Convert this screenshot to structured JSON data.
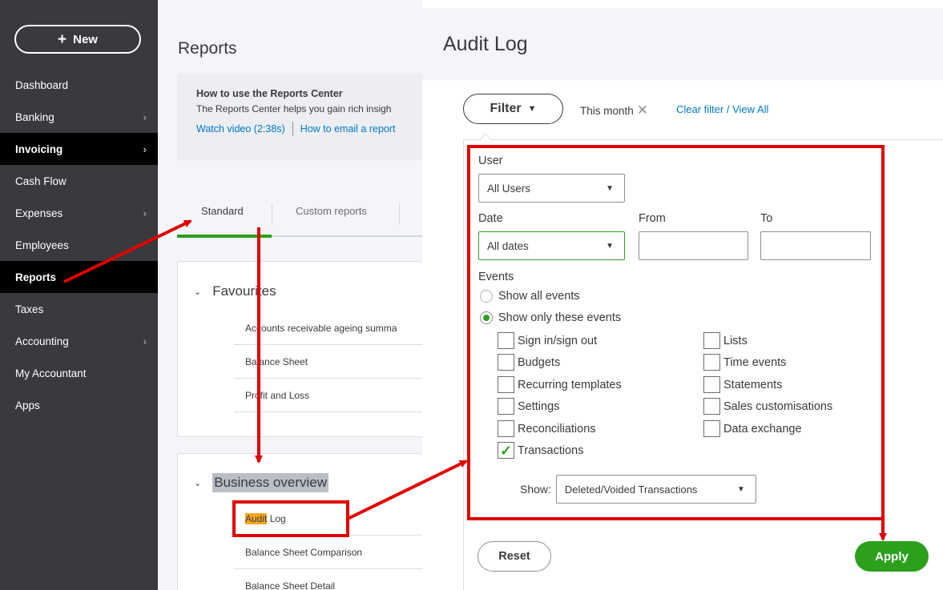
{
  "sidebar": {
    "new_label": "New",
    "items": [
      {
        "label": "Dashboard",
        "chevron": false,
        "active": false
      },
      {
        "label": "Banking",
        "chevron": true,
        "active": false
      },
      {
        "label": "Invoicing",
        "chevron": true,
        "active": true
      },
      {
        "label": "Cash Flow",
        "chevron": false,
        "active": false
      },
      {
        "label": "Expenses",
        "chevron": true,
        "active": false
      },
      {
        "label": "Employees",
        "chevron": false,
        "active": false
      },
      {
        "label": "Reports",
        "chevron": false,
        "active": true
      },
      {
        "label": "Taxes",
        "chevron": false,
        "active": false
      },
      {
        "label": "Accounting",
        "chevron": true,
        "active": false
      },
      {
        "label": "My Accountant",
        "chevron": false,
        "active": false
      },
      {
        "label": "Apps",
        "chevron": false,
        "active": false
      }
    ]
  },
  "reports": {
    "title": "Reports",
    "info_title": "How to use the Reports Center",
    "info_text": "The Reports Center helps you gain rich insigh",
    "watch_video": "Watch video (2:38s)",
    "email_link": "How to email a report",
    "tab_standard": "Standard",
    "tab_custom": "Custom reports",
    "favourites_title": "Favourites",
    "favourites": [
      "Accounts receivable ageing summa",
      "Balance Sheet",
      "Profit and Loss"
    ],
    "business_title": "Business overview",
    "audit_mark": "Audit",
    "audit_rest": " Log",
    "business_rows": [
      "Balance Sheet Comparison",
      "Balance Sheet Detail"
    ]
  },
  "audit": {
    "title": "Audit Log",
    "filter_label": "Filter",
    "this_month": "This month",
    "clear_link": "Clear filter / View All",
    "user_label": "User",
    "user_value": "All Users",
    "date_label": "Date",
    "date_value": "All dates",
    "from_label": "From",
    "to_label": "To",
    "events_label": "Events",
    "show_all": "Show all events",
    "show_only": "Show only these events",
    "events_left": [
      {
        "label": "Sign in/sign out",
        "checked": false
      },
      {
        "label": "Budgets",
        "checked": false
      },
      {
        "label": "Recurring templates",
        "checked": false
      },
      {
        "label": "Settings",
        "checked": false
      },
      {
        "label": "Reconciliations",
        "checked": false
      },
      {
        "label": "Transactions",
        "checked": true
      }
    ],
    "events_right": [
      {
        "label": "Lists",
        "checked": false
      },
      {
        "label": "Time events",
        "checked": false
      },
      {
        "label": "Statements",
        "checked": false
      },
      {
        "label": "Sales customisations",
        "checked": false
      },
      {
        "label": "Data exchange",
        "checked": false
      }
    ],
    "show_label": "Show:",
    "show_value": "Deleted/Voided Transactions",
    "reset_label": "Reset",
    "apply_label": "Apply"
  },
  "colors": {
    "sidebar_bg": "#393a3d",
    "accent_green": "#2ca01c",
    "link_blue": "#0077c5",
    "annotation_red": "#e00000",
    "highlight_orange": "#f5a623"
  }
}
